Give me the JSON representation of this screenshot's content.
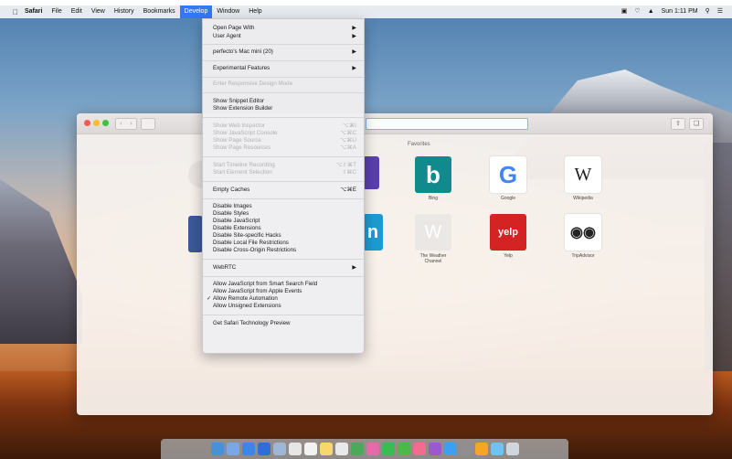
{
  "menubar": {
    "app": "Safari",
    "items": [
      "File",
      "Edit",
      "View",
      "History",
      "Bookmarks",
      "Develop",
      "Window",
      "Help"
    ],
    "active": "Develop",
    "clock": "Sun 1:11 PM"
  },
  "develop_menu": {
    "open_page_with": "Open Page With",
    "user_agent": "User Agent",
    "device": "perfecto's Mac mini (20)",
    "experimental": "Experimental Features",
    "responsive": "Enter Responsive Design Mode",
    "snippet_editor": "Show Snippet Editor",
    "extension_builder": "Show Extension Builder",
    "web_inspector": "Show Web Inspector",
    "web_inspector_sc": "⌥⌘I",
    "js_console": "Show JavaScript Console",
    "js_console_sc": "⌥⌘C",
    "page_source": "Show Page Source",
    "page_source_sc": "⌥⌘U",
    "page_resources": "Show Page Resources",
    "page_resources_sc": "⌥⌘A",
    "timeline": "Start Timeline Recording",
    "timeline_sc": "⌥⇧⌘T",
    "element_selection": "Start Element Selection",
    "element_selection_sc": "⇧⌘C",
    "empty_caches": "Empty Caches",
    "empty_caches_sc": "⌥⌘E",
    "disable_images": "Disable Images",
    "disable_styles": "Disable Styles",
    "disable_js": "Disable JavaScript",
    "disable_ext": "Disable Extensions",
    "disable_hacks": "Disable Site-specific Hacks",
    "disable_local": "Disable Local File Restrictions",
    "disable_cors": "Disable Cross-Origin Restrictions",
    "webrtc": "WebRTC",
    "allow_smart_search": "Allow JavaScript from Smart Search Field",
    "allow_apple_events": "Allow JavaScript from Apple Events",
    "allow_remote": "Allow Remote Automation",
    "allow_unsigned": "Allow Unsigned Extensions",
    "tech_preview": "Get Safari Technology Preview"
  },
  "favorites": {
    "title": "Favorites",
    "tiles": [
      {
        "label": "Bing"
      },
      {
        "label": "Google"
      },
      {
        "label": "Wikipedia"
      },
      {
        "label": "The Weather Channel"
      },
      {
        "label": "Yelp"
      },
      {
        "label": "TripAdvisor"
      }
    ]
  },
  "colors": {
    "accent": "#3478f6",
    "bing": "#108a8d",
    "yelp": "#d32323"
  }
}
